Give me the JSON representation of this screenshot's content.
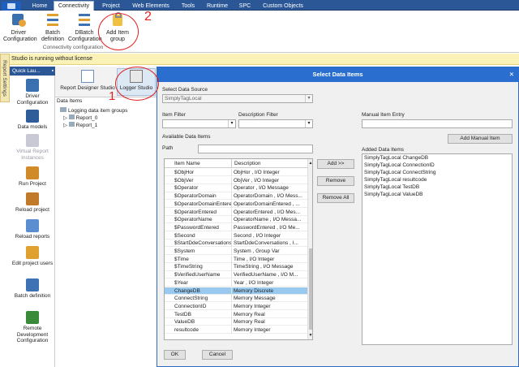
{
  "ribbon_tabs": [
    {
      "label": ""
    },
    {
      "label": "Home"
    },
    {
      "label": "Connectivity"
    },
    {
      "label": "Project"
    },
    {
      "label": "Web Elements"
    },
    {
      "label": "Tools"
    },
    {
      "label": "Runtime"
    },
    {
      "label": "SPC"
    },
    {
      "label": "Custom Objects"
    }
  ],
  "ribbon": {
    "buttons": [
      {
        "label": "Driver Configuration",
        "icon": "driver-configuration-icon"
      },
      {
        "label": "Batch definition",
        "icon": "batch-definition-icon"
      },
      {
        "label": "DBatch Configuration",
        "icon": "dbatch-configuration-icon"
      },
      {
        "label": "Add Item group",
        "icon": "add-item-group-icon"
      }
    ],
    "group_label": "Connectivity configuration"
  },
  "annotations": {
    "one": "1",
    "two": "2"
  },
  "infobar": {
    "text": "Studio is running without license"
  },
  "side_tab": {
    "label": "Report Settings"
  },
  "quick_launch": {
    "title": "Quick Lau...",
    "items": [
      {
        "label": "Driver Configuration",
        "color": "#3a6fb0"
      },
      {
        "label": "Data models",
        "color": "#2f5d9a"
      },
      {
        "label": "Virtual Report Instances",
        "color": "#c9c9d6"
      },
      {
        "label": "Run Project",
        "color": "#d08a2a"
      },
      {
        "label": "Reload project",
        "color": "#c07a2a"
      },
      {
        "label": "Reload reports",
        "color": "#5b8ed0"
      },
      {
        "label": "Edit project users",
        "color": "#e0a030"
      },
      {
        "label": "Batch definition",
        "color": "#3f72b5"
      },
      {
        "label": "Remote Development Configuration",
        "color": "#3a8a3a"
      }
    ]
  },
  "studios": {
    "report_designer": "Report Designer Studio",
    "logger": "Logger Studio"
  },
  "data_items": {
    "header": "Data Items",
    "root": "Logging data item groups",
    "children": [
      "Report_0",
      "Report_1"
    ]
  },
  "dialog": {
    "title": "Select Data Items",
    "source_label": "Select Data Source",
    "source_value": "SimplyTagLocal",
    "item_filter_label": "Item Filter",
    "desc_filter_label": "Description Filter",
    "available_label": "Available Data Items",
    "path_label": "Path",
    "columns": [
      "Item Name",
      "Description"
    ],
    "rows": [
      {
        "name": "$ObjHor",
        "desc": "ObjHor , I/O Integer"
      },
      {
        "name": "$ObjVer",
        "desc": "ObjVer , I/O Integer"
      },
      {
        "name": "$Operator",
        "desc": "Operator , I/O Message"
      },
      {
        "name": "$OperatorDomain",
        "desc": "OperatorDomain , I/O Mess..."
      },
      {
        "name": "$OperatorDomainEntere...",
        "desc": "OperatorDomainEntered , ..."
      },
      {
        "name": "$OperatorEntered",
        "desc": "OperatorEntered , I/O Mes..."
      },
      {
        "name": "$OperatorName",
        "desc": "OperatorName , I/O Messa..."
      },
      {
        "name": "$PasswordEntered",
        "desc": "PasswordEntered , I/O Me..."
      },
      {
        "name": "$Second",
        "desc": "Second , I/O Integer"
      },
      {
        "name": "$StartDdeConversations",
        "desc": "StartDdeConversations , I..."
      },
      {
        "name": "$System",
        "desc": "System , Group Var"
      },
      {
        "name": "$Time",
        "desc": "Time , I/O Integer"
      },
      {
        "name": "$TimeString",
        "desc": "TimeString , I/O Message"
      },
      {
        "name": "$VerifiedUserName",
        "desc": "VerifiedUserName , I/O M..."
      },
      {
        "name": "$Year",
        "desc": "Year , I/O Integer"
      },
      {
        "name": "ChangeDB",
        "desc": "Memory Discrete"
      },
      {
        "name": "ConnectString",
        "desc": "Memory Message"
      },
      {
        "name": "ConnectionID",
        "desc": "Memory Integer"
      },
      {
        "name": "TestDB",
        "desc": "Memory Real"
      },
      {
        "name": "ValueDB",
        "desc": "Memory Real"
      },
      {
        "name": "resultcode",
        "desc": "Memory Integer"
      }
    ],
    "selected_row": "ChangeDB",
    "add_button": "Add >>",
    "remove_button": "Remove",
    "remove_all_button": "Remove All",
    "manual_label": "Manual Item Entry",
    "add_manual_button": "Add Manual Item",
    "added_label": "Added Data Items",
    "added_items": [
      "SimplyTagLocal ChangeDB",
      "SimplyTagLocal ConnectionID",
      "SimplyTagLocal ConnectString",
      "SimplyTagLocal resultcode",
      "SimplyTagLocal TestDB",
      "SimplyTagLocal ValueDB"
    ],
    "ok_button": "OK",
    "cancel_button": "Cancel",
    "close_glyph": "✕"
  },
  "colors": {
    "accent": "#2b5797",
    "dialog_title": "#2a6fd0",
    "selection": "#99c9ef",
    "infobar": "#fbf2b8",
    "annotation": "#e02020"
  }
}
